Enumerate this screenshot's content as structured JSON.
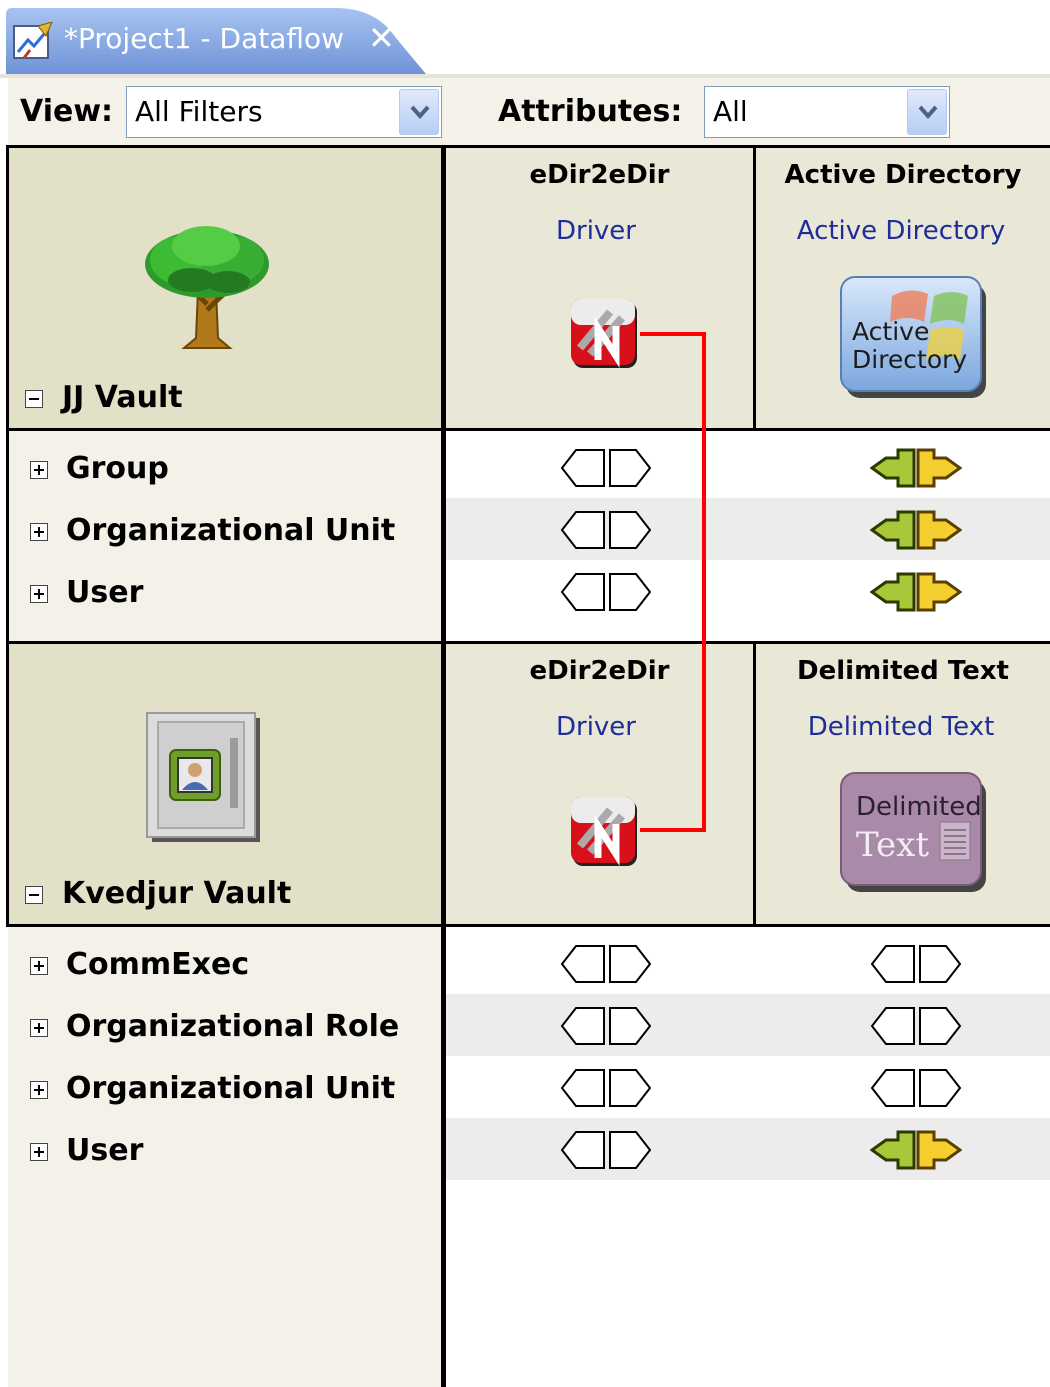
{
  "tab": {
    "title": "*Project1 - Dataflow",
    "close_glyph": "✕"
  },
  "toolbar": {
    "view_label": "View:",
    "view_value": "All Filters",
    "attributes_label": "Attributes:",
    "attributes_value": "All"
  },
  "vaults": [
    {
      "name": "JJ Vault",
      "icon": "tree-icon",
      "columns": [
        {
          "name": "eDir2eDir",
          "link": "Driver",
          "icon": "edir-driver-icon"
        },
        {
          "name": "Active Directory",
          "link": "Active Directory",
          "icon": "active-directory-icon",
          "icon_text": [
            "Active",
            "Directory"
          ]
        }
      ],
      "classes": [
        {
          "label": "Group",
          "filters": [
            "none",
            "sync"
          ]
        },
        {
          "label": "Organizational Unit",
          "filters": [
            "none",
            "sync"
          ]
        },
        {
          "label": "User",
          "filters": [
            "none",
            "sync"
          ]
        }
      ]
    },
    {
      "name": "Kvedjur Vault",
      "icon": "vault-safe-icon",
      "columns": [
        {
          "name": "eDir2eDir",
          "link": "Driver",
          "icon": "edir-driver-icon"
        },
        {
          "name": "Delimited Text",
          "link": "Delimited Text",
          "icon": "delimited-text-icon",
          "icon_text": [
            "Delimited",
            "Text"
          ]
        }
      ],
      "classes": [
        {
          "label": "CommExec",
          "filters": [
            "none",
            "none"
          ]
        },
        {
          "label": "Organizational Role",
          "filters": [
            "none",
            "none"
          ]
        },
        {
          "label": "Organizational Unit",
          "filters": [
            "none",
            "none"
          ]
        },
        {
          "label": "User",
          "filters": [
            "none",
            "sync"
          ]
        }
      ]
    }
  ],
  "colors": {
    "connection_line": "#ff0000",
    "link": "#1f2d9a",
    "sync_left": "#a8c83a",
    "sync_right": "#f5cf30"
  }
}
